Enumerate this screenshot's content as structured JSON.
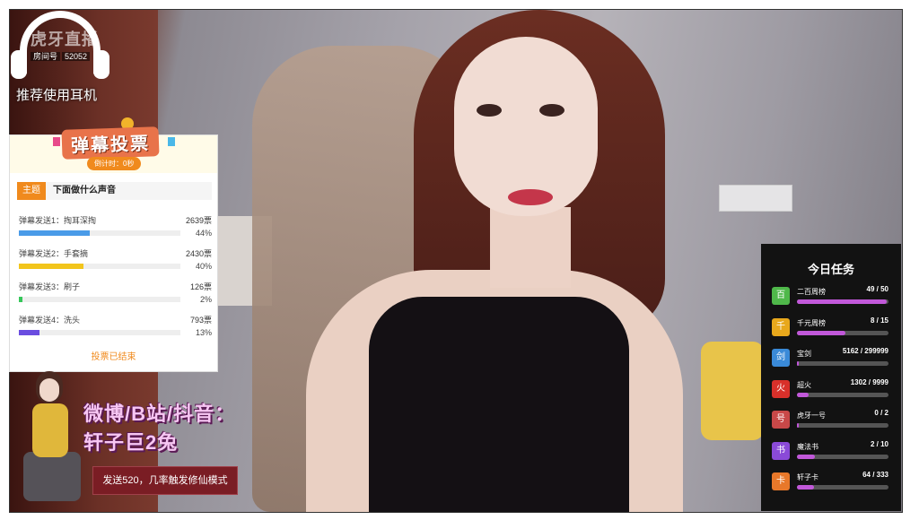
{
  "headphone": {
    "logo": "虎牙直播",
    "room_label": "房间号",
    "room_number": "52052",
    "hint": "推荐使用耳机"
  },
  "vote": {
    "title": "弹幕投票",
    "timer": "倒计时：0秒",
    "topic_tag": "主题",
    "topic": "下面做什么声音",
    "options": [
      {
        "label": "弹幕发送1：掏耳深掏",
        "count": "2639票",
        "percent": "44%",
        "value": 44,
        "color": "#4a9be8"
      },
      {
        "label": "弹幕发送2：手套摘",
        "count": "2430票",
        "percent": "40%",
        "value": 40,
        "color": "#f2c51c"
      },
      {
        "label": "弹幕发送3：刷子",
        "count": "126票",
        "percent": "2%",
        "value": 2,
        "color": "#36c75a"
      },
      {
        "label": "弹幕发送4：洗头",
        "count": "793票",
        "percent": "13%",
        "value": 13,
        "color": "#6a4de0"
      }
    ],
    "status": "投票已结束"
  },
  "promo": {
    "line1": "微博/B站/抖音：",
    "line2": "轩子巨2兔",
    "mode": "发送520，几率触发修仙模式"
  },
  "tasks": {
    "title": "今日任务",
    "items": [
      {
        "name": "二百周榜",
        "progress": "49 / 50",
        "fraction": 0.98,
        "icon": "百",
        "icon_color": "#4fb84a"
      },
      {
        "name": "千元周榜",
        "progress": "8 / 15",
        "fraction": 0.53,
        "icon": "千",
        "icon_color": "#e8a81c"
      },
      {
        "name": "宝剑",
        "progress": "5162 / 299999",
        "fraction": 0.02,
        "icon": "剑",
        "icon_color": "#3a8ad8"
      },
      {
        "name": "超火",
        "progress": "1302 / 9999",
        "fraction": 0.13,
        "icon": "火",
        "icon_color": "#d8302a"
      },
      {
        "name": "虎牙一号",
        "progress": "0 / 2",
        "fraction": 0.0,
        "icon": "号",
        "icon_color": "#c84848"
      },
      {
        "name": "魔法书",
        "progress": "2 / 10",
        "fraction": 0.2,
        "icon": "书",
        "icon_color": "#8a4ad8"
      },
      {
        "name": "轩子卡",
        "progress": "64 / 333",
        "fraction": 0.19,
        "icon": "卡",
        "icon_color": "#e8782a"
      }
    ]
  }
}
